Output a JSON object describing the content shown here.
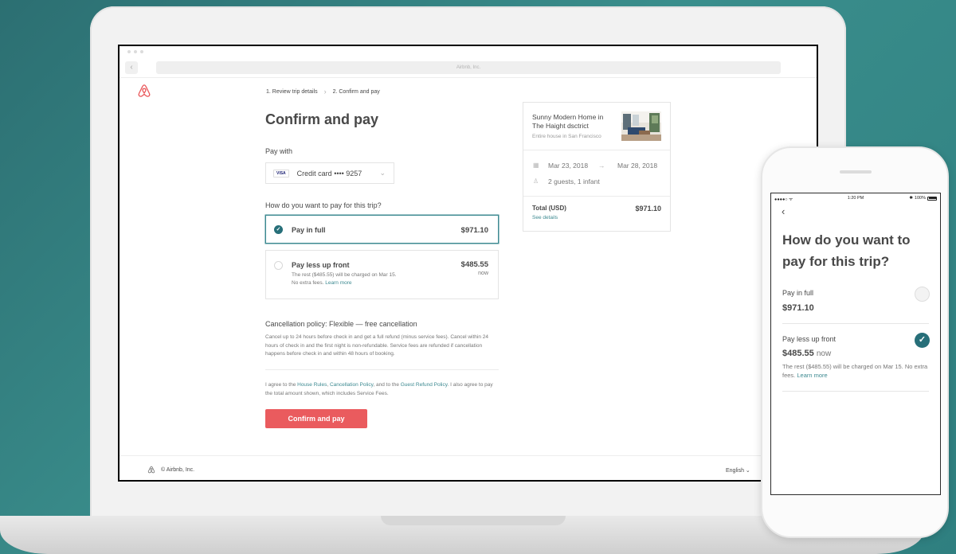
{
  "browser": {
    "url_text": "Airbnb, Inc.",
    "back_glyph": "‹"
  },
  "breadcrumb": {
    "step1": "1. Review trip details",
    "step2": "2. Confirm and pay",
    "separator": "›"
  },
  "main": {
    "title": "Confirm and pay",
    "pay_with_label": "Pay with",
    "card": {
      "brand": "VISA",
      "text": "Credit card •••• 9257"
    },
    "question": "How do you want to pay for this trip?",
    "options": [
      {
        "label": "Pay in full",
        "amount": "$971.10",
        "selected": true
      },
      {
        "label": "Pay less up front",
        "amount": "$485.55",
        "amount_sub": "now",
        "desc_1": "The rest ($485.55) will be charged on Mar 15.",
        "desc_2": "No extra fees.",
        "learn_more": "Learn more",
        "selected": false
      }
    ],
    "policy_title": "Cancellation policy: Flexible — free cancellation",
    "policy_text": "Cancel up to 24 hours before check in and get a full refund (minus service fees). Cancel within 24 hours of check in and the first night is non-refundable. Service fees are refunded if cancellation happens before check in and within 48 hours of booking.",
    "agree": {
      "part1": "I agree to the ",
      "house_rules": "House Rules",
      "comma": ", ",
      "cancellation_policy": "Cancellation Policy",
      "part2": ", and to the ",
      "guest_refund_policy": "Guest Refund Policy",
      "part3": ". I also agree to pay the total amount shown, which includes Service Fees."
    },
    "confirm_button": "Confirm and pay"
  },
  "summary": {
    "listing_title": "Sunny Modern Home in The Haight dsctrict",
    "listing_sub": "Entire house in San Francisco",
    "check_in": "Mar 23, 2018",
    "arrow": "→",
    "check_out": "Mar 28, 2018",
    "guests": "2 guests, 1 infant",
    "total_label": "Total (USD)",
    "total_amount": "$971.10",
    "see_details": "See details"
  },
  "footer": {
    "copyright": "© Airbnb, Inc.",
    "language": "English ⌄"
  },
  "mobile": {
    "status": {
      "signal": "●●●●○ ᯤ",
      "time": "1:20 PM",
      "bluetooth": "✱",
      "battery_pct": "100%"
    },
    "back_glyph": "‹",
    "title": "How do you want to pay for this trip?",
    "options": [
      {
        "label": "Pay in full",
        "amount": "$971.10",
        "selected": false
      },
      {
        "label": "Pay less up front",
        "amount": "$485.55",
        "amount_sub": "now",
        "desc": "The rest ($485.55) will be charged on Mar 15. No extra fees.",
        "learn_more": "Learn more",
        "selected": true
      }
    ]
  },
  "colors": {
    "brand_red": "#ea5b5e",
    "accent_teal": "#276f79",
    "link_teal": "#3d8a91",
    "background": "#2f7f80"
  }
}
